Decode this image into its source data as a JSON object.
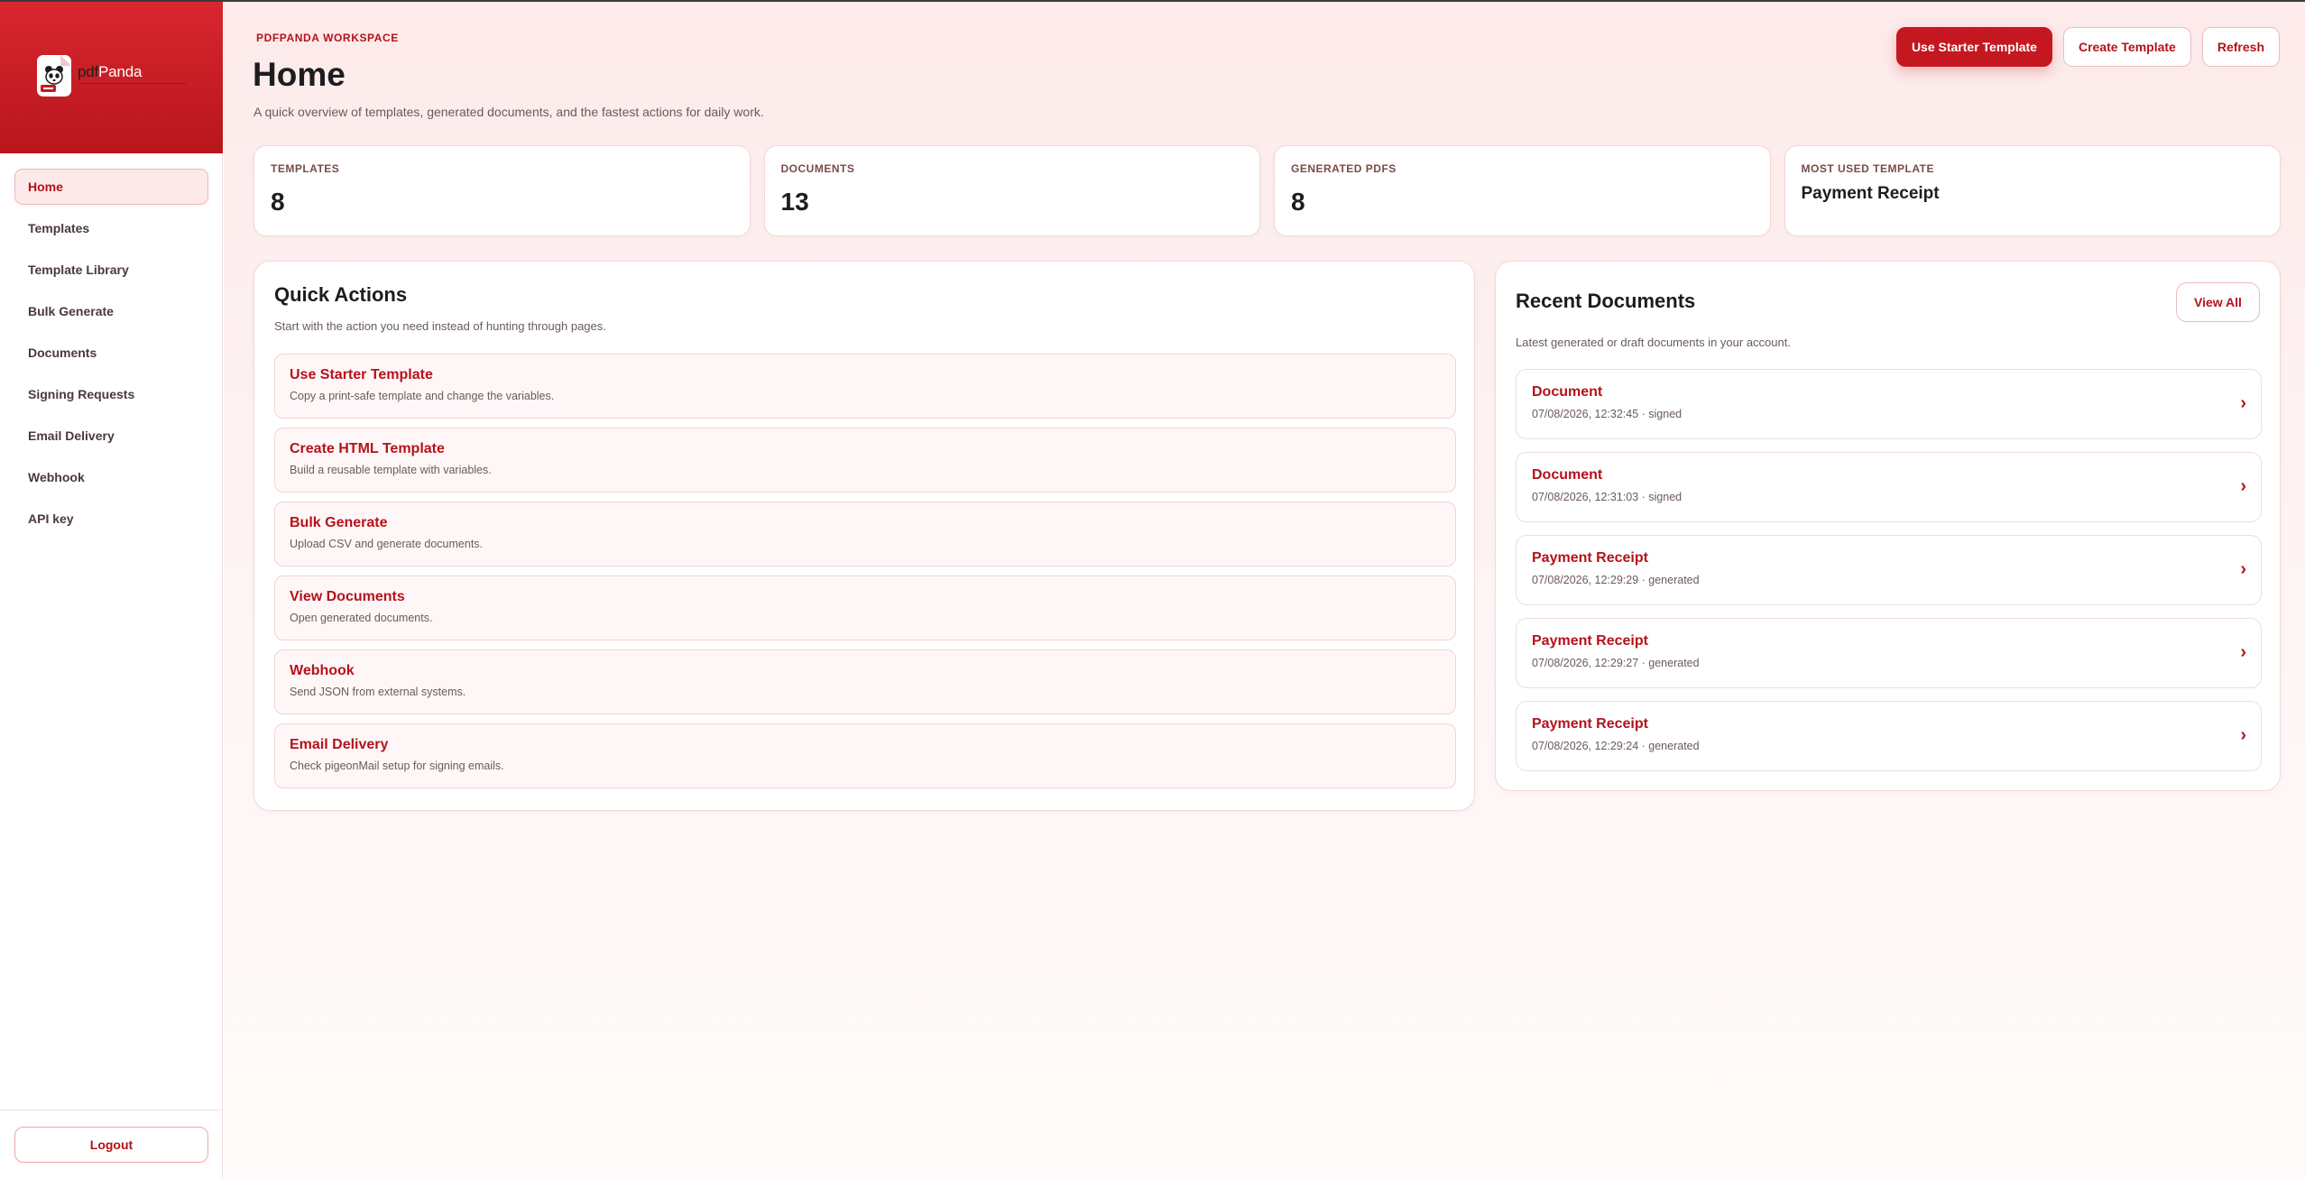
{
  "brand": {
    "name_prefix": "pdf",
    "name_suffix": "Panda"
  },
  "sidebar": {
    "items": [
      {
        "label": "Home",
        "active": true
      },
      {
        "label": "Templates"
      },
      {
        "label": "Template Library"
      },
      {
        "label": "Bulk Generate"
      },
      {
        "label": "Documents"
      },
      {
        "label": "Signing Requests"
      },
      {
        "label": "Email Delivery"
      },
      {
        "label": "Webhook"
      },
      {
        "label": "API key"
      }
    ],
    "logout_label": "Logout"
  },
  "header": {
    "eyebrow": "PDFPANDA WORKSPACE",
    "title": "Home",
    "subtitle": "A quick overview of templates, generated documents, and the fastest actions for daily work.",
    "buttons": {
      "use_starter": "Use Starter Template",
      "create_template": "Create Template",
      "refresh": "Refresh"
    }
  },
  "stats": [
    {
      "label": "TEMPLATES",
      "value": "8"
    },
    {
      "label": "DOCUMENTS",
      "value": "13"
    },
    {
      "label": "GENERATED PDFS",
      "value": "8"
    },
    {
      "label": "MOST USED TEMPLATE",
      "value": "Payment Receipt"
    }
  ],
  "quick_actions": {
    "title": "Quick Actions",
    "subtitle": "Start with the action you need instead of hunting through pages.",
    "items": [
      {
        "title": "Use Starter Template",
        "desc": "Copy a print-safe template and change the variables."
      },
      {
        "title": "Create HTML Template",
        "desc": "Build a reusable template with variables."
      },
      {
        "title": "Bulk Generate",
        "desc": "Upload CSV and generate documents."
      },
      {
        "title": "View Documents",
        "desc": "Open generated documents."
      },
      {
        "title": "Webhook",
        "desc": "Send JSON from external systems."
      },
      {
        "title": "Email Delivery",
        "desc": "Check pigeonMail setup for signing emails."
      }
    ]
  },
  "recent_documents": {
    "title": "Recent Documents",
    "subtitle": "Latest generated or draft documents in your account.",
    "view_all_label": "View All",
    "items": [
      {
        "title": "Document",
        "meta": "07/08/2026, 12:32:45 · signed"
      },
      {
        "title": "Document",
        "meta": "07/08/2026, 12:31:03 · signed"
      },
      {
        "title": "Payment Receipt",
        "meta": "07/08/2026, 12:29:29 · generated"
      },
      {
        "title": "Payment Receipt",
        "meta": "07/08/2026, 12:29:27 · generated"
      },
      {
        "title": "Payment Receipt",
        "meta": "07/08/2026, 12:29:24 · generated"
      }
    ]
  },
  "icons": {
    "logo": "panda-document-icon",
    "row_arrow": "chevron-right-icon"
  },
  "colors": {
    "brand_red": "#c5171f",
    "accent_text": "#b5121b",
    "sidebar_header": "#d9262f"
  }
}
